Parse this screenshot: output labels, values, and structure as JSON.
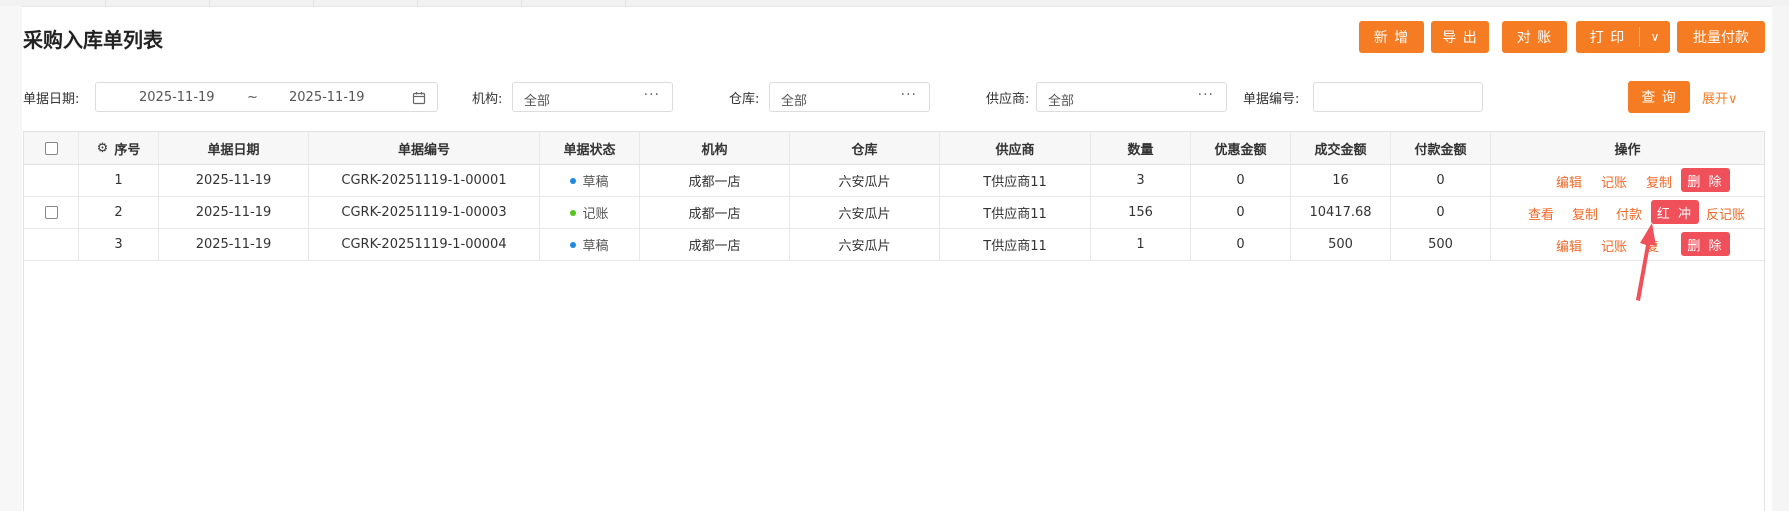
{
  "page": {
    "title": "采购入库单列表"
  },
  "toolbar": {
    "add": "新 增",
    "export": "导 出",
    "reconcile": "对 账",
    "print": "打 印",
    "print_caret": "∨",
    "batch_pay": "批量付款"
  },
  "filters": {
    "date_label": "单据日期:",
    "date_from": "2025-11-19",
    "date_sep": "~",
    "date_to": "2025-11-19",
    "org_label": "机构:",
    "org_value": "全部",
    "wh_label": "仓库:",
    "wh_value": "全部",
    "supplier_label": "供应商:",
    "supplier_value": "全部",
    "docno_label": "单据编号:",
    "docno_value": "",
    "more": "···",
    "query": "查 询",
    "expand": "展开∨"
  },
  "table": {
    "columns": [
      "序号",
      "单据日期",
      "单据编号",
      "单据状态",
      "机构",
      "仓库",
      "供应商",
      "数量",
      "优惠金额",
      "成交金额",
      "付款金额",
      "操作"
    ],
    "rows": [
      {
        "no": "1",
        "date": "2025-11-19",
        "docno": "CGRK-20251119-1-00001",
        "status": "草稿",
        "org": "成都一店",
        "wh": "六安瓜片",
        "supplier": "T供应商11",
        "qty": "3",
        "discount": "0",
        "amount": "16",
        "paid": "0",
        "ops": {
          "a": "编辑",
          "b": "记账",
          "c": "复制",
          "d": "删 除"
        }
      },
      {
        "no": "2",
        "date": "2025-11-19",
        "docno": "CGRK-20251119-1-00003",
        "status": "记账",
        "org": "成都一店",
        "wh": "六安瓜片",
        "supplier": "T供应商11",
        "qty": "156",
        "discount": "0",
        "amount": "10417.68",
        "paid": "0",
        "ops": {
          "a": "查看",
          "b": "复制",
          "c": "付款",
          "d": "红 冲",
          "e": "反记账"
        }
      },
      {
        "no": "3",
        "date": "2025-11-19",
        "docno": "CGRK-20251119-1-00004",
        "status": "草稿",
        "org": "成都一店",
        "wh": "六安瓜片",
        "supplier": "T供应商11",
        "qty": "1",
        "discount": "0",
        "amount": "500",
        "paid": "500",
        "ops": {
          "a": "编辑",
          "b": "记账",
          "c": "复",
          "d": "删 除"
        }
      }
    ]
  },
  "colors": {
    "accent": "#f57c22",
    "danger": "#f0505a",
    "draft_dot": "#1e88e5",
    "posted_dot": "#52c41a",
    "arrow": "#f0505a"
  },
  "icons": {
    "settings": "gear-icon",
    "calendar": "calendar-icon"
  }
}
